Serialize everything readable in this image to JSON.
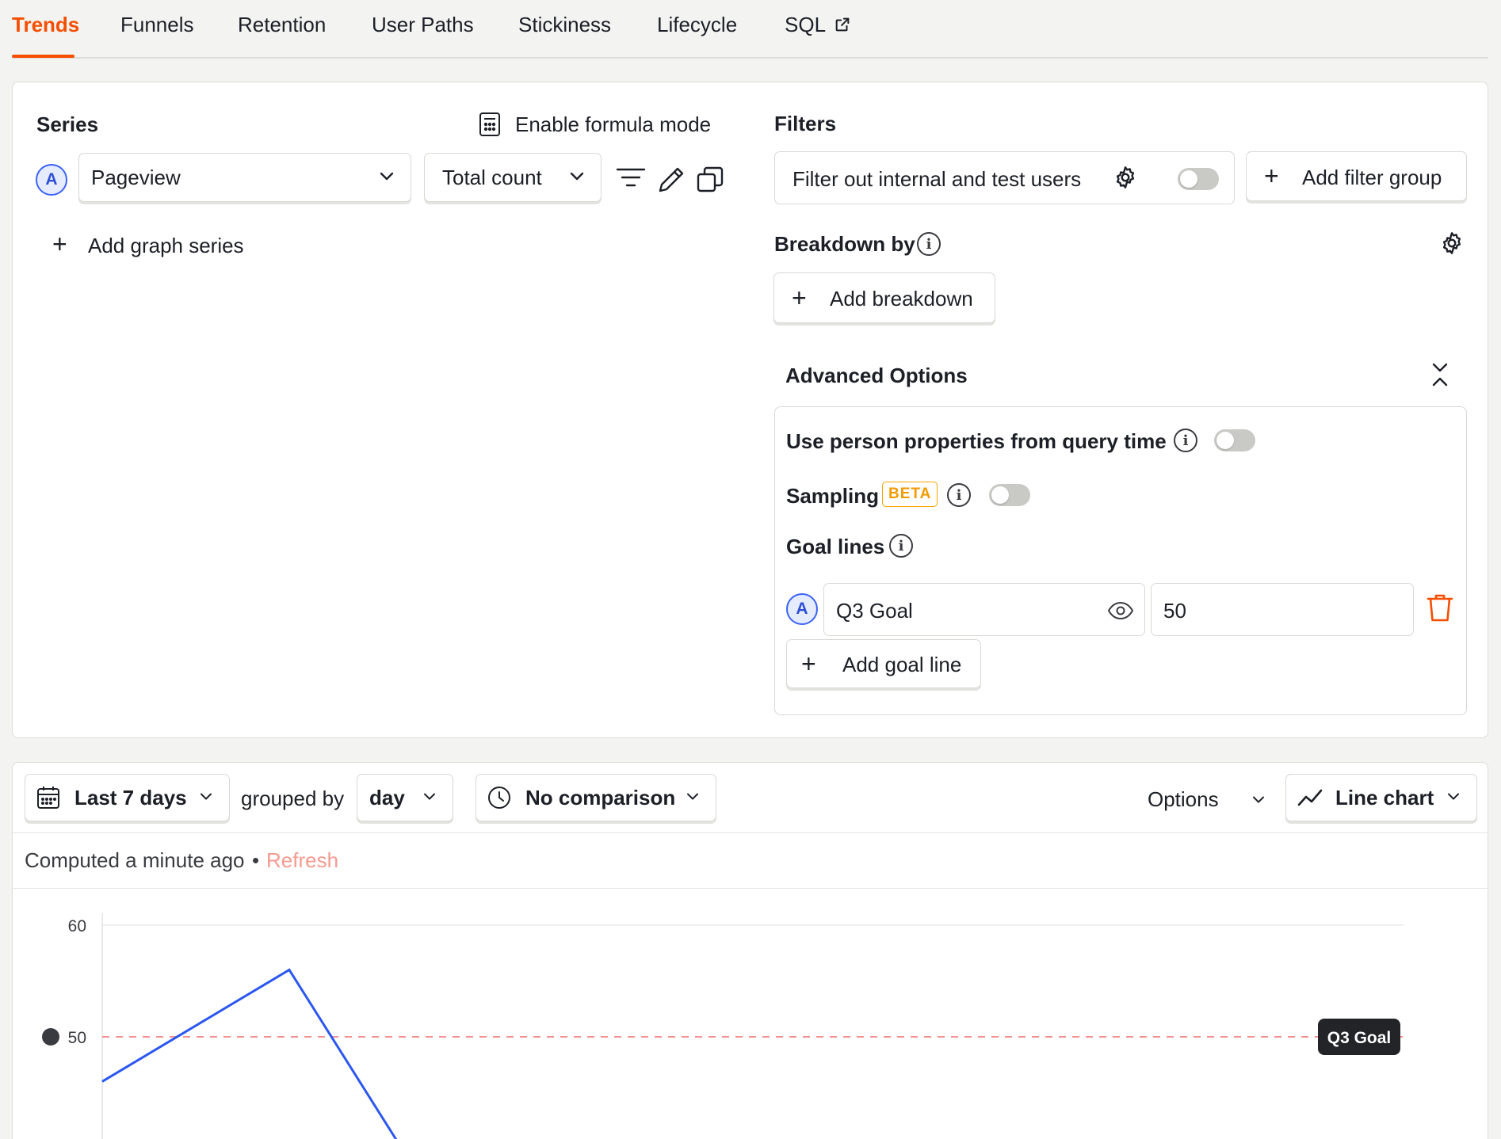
{
  "tabs": [
    {
      "label": "Trends",
      "active": true
    },
    {
      "label": "Funnels"
    },
    {
      "label": "Retention"
    },
    {
      "label": "User Paths"
    },
    {
      "label": "Stickiness"
    },
    {
      "label": "Lifecycle"
    },
    {
      "label": "SQL"
    }
  ],
  "series": {
    "heading": "Series",
    "formula_mode_label": "Enable formula mode",
    "items": [
      {
        "letter": "A",
        "event": "Pageview",
        "math": "Total count"
      }
    ],
    "add_series_label": "Add graph series"
  },
  "filters": {
    "heading": "Filters",
    "internal_users_label": "Filter out internal and test users",
    "internal_users_enabled": false,
    "add_filter_group_label": "Add filter group"
  },
  "breakdown": {
    "heading": "Breakdown by",
    "add_label": "Add breakdown"
  },
  "advanced": {
    "heading": "Advanced Options",
    "person_props_label": "Use person properties from query time",
    "person_props_enabled": false,
    "sampling_label": "Sampling",
    "sampling_badge": "BETA",
    "sampling_enabled": false,
    "goal_lines_label": "Goal lines",
    "goal_lines": [
      {
        "letter": "A",
        "name": "Q3 Goal",
        "value": "50"
      }
    ],
    "add_goal_line_label": "Add goal line"
  },
  "toolbar": {
    "date_range": "Last 7 days",
    "grouped_by_label": "grouped by",
    "interval": "day",
    "comparison": "No comparison",
    "options_label": "Options",
    "chart_type": "Line chart"
  },
  "status": {
    "computed_text": "Computed a minute ago",
    "separator": "•",
    "refresh_label": "Refresh"
  },
  "colors": {
    "accent": "#f54e00",
    "series_a": "#2b57f0",
    "goal_line": "#f26d6d",
    "beta": "#f29a00"
  },
  "chart_data": {
    "type": "line",
    "ylim": [
      40,
      60
    ],
    "yticks": [
      60,
      50
    ],
    "series": [
      {
        "values": [
          46,
          56,
          40
        ]
      }
    ],
    "goal_line": {
      "label": "Q3 Goal",
      "value": 50
    }
  }
}
